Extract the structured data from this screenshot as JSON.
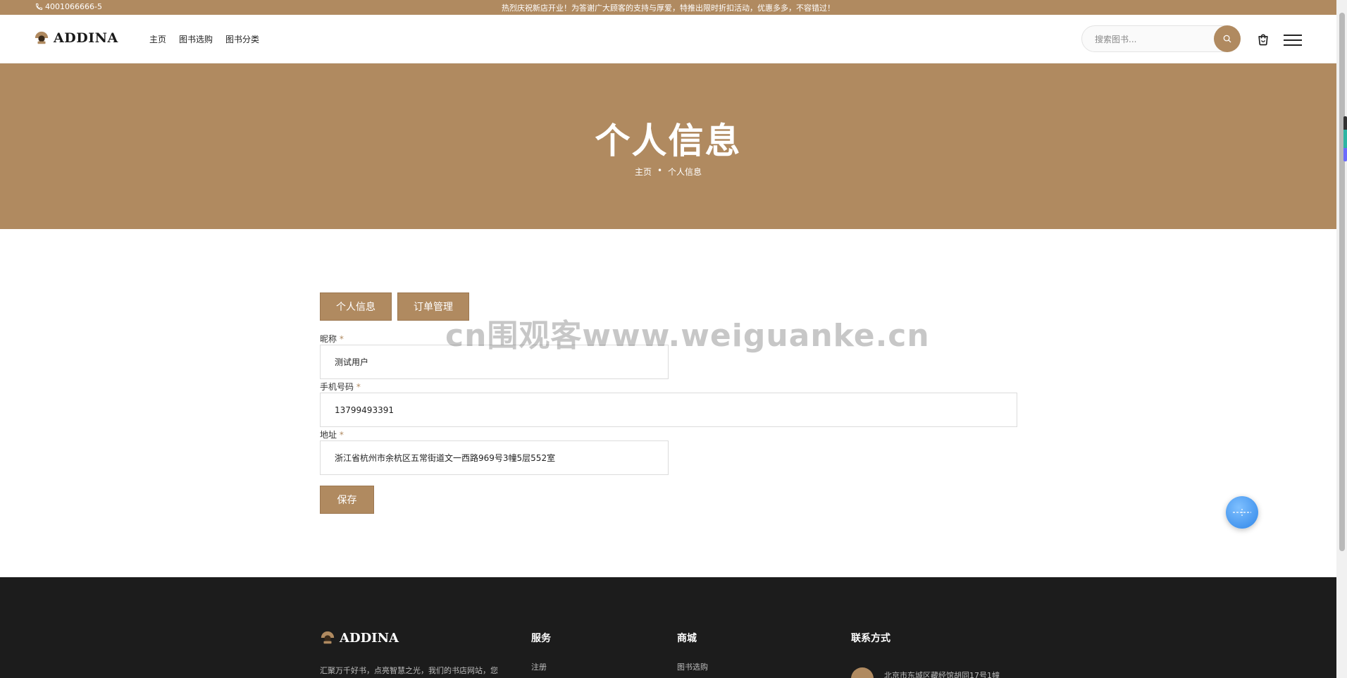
{
  "topbar": {
    "phone": "4001066666-5",
    "notice": "热烈庆祝新店开业！为答谢广大顾客的支持与厚爱，特推出限时折扣活动，优惠多多，不容错过！"
  },
  "header": {
    "logo_text": "ADDINA",
    "nav": [
      "主页",
      "图书选购",
      "图书分类"
    ],
    "search_placeholder": "搜索图书...",
    "icons": [
      "search-icon",
      "cart-icon",
      "menu-icon"
    ]
  },
  "hero": {
    "title": "个人信息",
    "breadcrumb": {
      "home": "主页",
      "separator": "•",
      "current": "个人信息"
    }
  },
  "content": {
    "tabs": [
      "个人信息",
      "订单管理"
    ],
    "fields": {
      "nickname": {
        "label": "昵称",
        "required": "*",
        "value": "测试用户"
      },
      "phone": {
        "label": "手机号码",
        "required": "*",
        "value": "13799493391"
      },
      "address": {
        "label": "地址",
        "required": "*",
        "value": "浙江省杭州市余杭区五常街道文一西路969号3幢5层552室"
      }
    },
    "save_label": "保存"
  },
  "watermark": "cn围观客www.weiguanke.cn",
  "footer": {
    "logo_text": "ADDINA",
    "description": "汇聚万千好书，点亮智慧之光，我们的书店网站，您",
    "columns": [
      {
        "title": "服务",
        "link": "注册"
      },
      {
        "title": "商城",
        "link": "图书选购"
      },
      {
        "title": "联系方式",
        "link": "北京市东城区藏经馆胡同17号1幢"
      }
    ]
  },
  "colors": {
    "brand": "#b08a60",
    "footer_bg": "#1c1c1c",
    "float_button": "#2f86e8"
  }
}
